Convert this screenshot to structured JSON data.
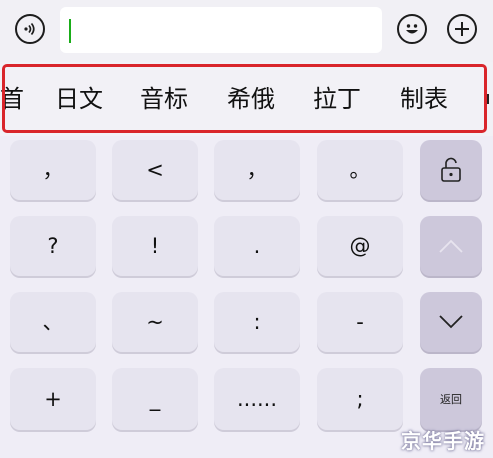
{
  "input_bar": {
    "text_value": "",
    "voice_button": "voice-icon",
    "emoji_button": "smiley-icon",
    "plus_button": "plus-icon"
  },
  "candidates": [
    {
      "label": "首"
    },
    {
      "label": "日文"
    },
    {
      "label": "音标"
    },
    {
      "label": "希俄"
    },
    {
      "label": "拉丁"
    },
    {
      "label": "制表"
    }
  ],
  "keyboard": {
    "rows": [
      {
        "keys": [
          {
            "label": "，"
          },
          {
            "label": "<"
          },
          {
            "label": "，"
          },
          {
            "label": "。"
          }
        ]
      },
      {
        "keys": [
          {
            "label": "?"
          },
          {
            "label": "!"
          },
          {
            "label": "."
          },
          {
            "label": "@"
          }
        ]
      },
      {
        "keys": [
          {
            "label": "、"
          },
          {
            "label": "~"
          },
          {
            "label": ":"
          },
          {
            "label": "-"
          }
        ]
      },
      {
        "keys": [
          {
            "label": "+"
          },
          {
            "label": "_"
          },
          {
            "label": "......"
          },
          {
            "label": ";"
          }
        ]
      }
    ],
    "side": {
      "lock_icon": "unlock-icon",
      "up_icon": "chevron-up-icon",
      "down_icon": "chevron-down-icon",
      "back_label": "返回"
    }
  },
  "watermark": "京华手游",
  "colors": {
    "highlight_frame": "#d9252b",
    "caret": "#1aad19",
    "key_bg": "#e6e4ef",
    "side_key_bg": "#cdc8db"
  }
}
